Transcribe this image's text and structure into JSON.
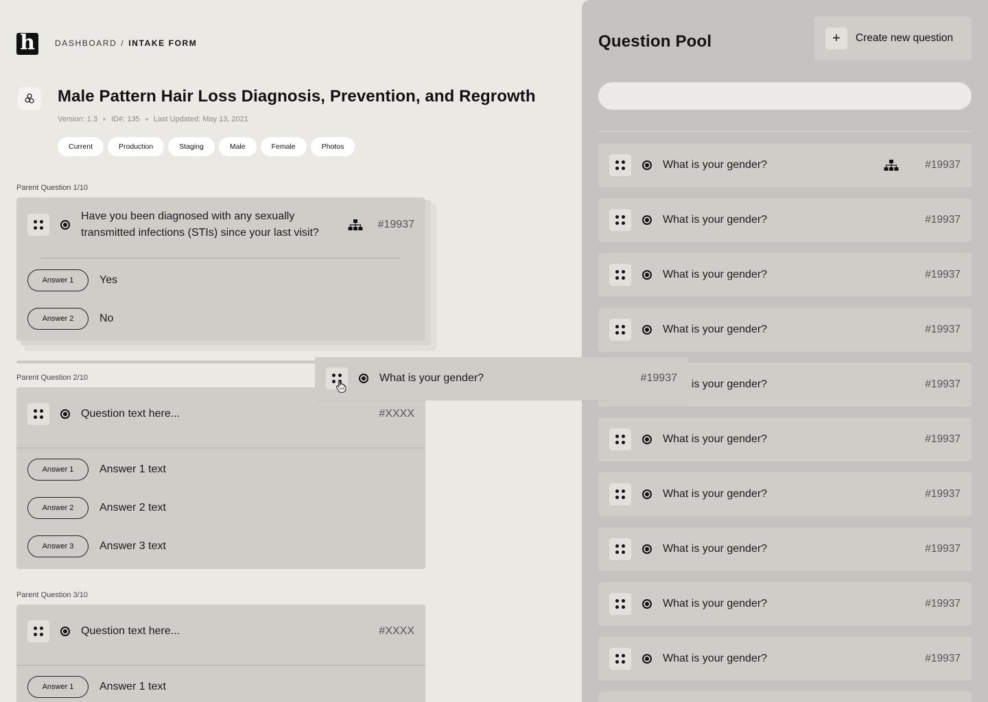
{
  "header": {
    "logo_letter": "h",
    "breadcrumb": {
      "root": "DASHBOARD",
      "separator": "/",
      "current": "INTAKE FORM"
    },
    "title": "Male Pattern Hair Loss Diagnosis, Prevention, and Regrowth",
    "meta": {
      "version": "Version: 1.3",
      "id": "ID#: 135",
      "updated": "Last Updated: May 13, 2021"
    },
    "tags": [
      "Current",
      "Production",
      "Staging",
      "Male",
      "Female",
      "Photos"
    ]
  },
  "questions": [
    {
      "label": "Parent Question 1/10",
      "text": "Have you been diagnosed with any sexually transmitted infections (STIs) since your last visit?",
      "id": "#19937",
      "has_tree_icon": true,
      "answers": [
        {
          "pill": "Answer 1",
          "text": "Yes"
        },
        {
          "pill": "Answer 2",
          "text": "No"
        }
      ]
    },
    {
      "label": "Parent Question 2/10",
      "text": "Question text here...",
      "id": "#XXXX",
      "answers": [
        {
          "pill": "Answer 1",
          "text": "Answer 1 text"
        },
        {
          "pill": "Answer 2",
          "text": "Answer 2 text"
        },
        {
          "pill": "Answer 3",
          "text": "Answer 3 text"
        }
      ]
    },
    {
      "label": "Parent Question 3/10",
      "text": "Question text here...",
      "id": "#XXXX",
      "answers": [
        {
          "pill": "Answer 1",
          "text": "Answer 1 text"
        }
      ]
    }
  ],
  "dragged": {
    "text": "What is your gender?",
    "id": "#19937"
  },
  "pool": {
    "title": "Question Pool",
    "create_label": "Create new question",
    "create_icon": "+",
    "search_placeholder": "",
    "items": [
      {
        "text": "What is your gender?",
        "id": "#19937",
        "has_tree_icon": true
      },
      {
        "text": "What is your gender?",
        "id": "#19937"
      },
      {
        "text": "What is your gender?",
        "id": "#19937"
      },
      {
        "text": "What is your gender?",
        "id": "#19937"
      },
      {
        "text": "What is your gender?",
        "id": "#19937"
      },
      {
        "text": "What is your gender?",
        "id": "#19937"
      },
      {
        "text": "What is your gender?",
        "id": "#19937"
      },
      {
        "text": "What is your gender?",
        "id": "#19937"
      },
      {
        "text": "What is your gender?",
        "id": "#19937"
      },
      {
        "text": "What is your gender?",
        "id": "#19937"
      }
    ]
  },
  "colors": {
    "page_bg": "#ebe9e4",
    "panel_bg": "#c4c3c0",
    "card_bg": "#cfcdc8",
    "handle_bg": "#e2e0db"
  }
}
